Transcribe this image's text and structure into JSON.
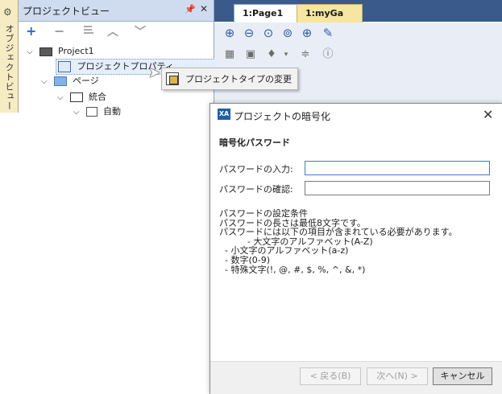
{
  "side_tab": {
    "label": "オブジェクトビュー"
  },
  "project_view": {
    "title": "プロジェクトビュー",
    "pin_icon": "pin-icon",
    "close_glyph": "✕",
    "toolbar": {
      "add": "+",
      "remove": "−",
      "rename_icon": "rename-icon",
      "up": "︿",
      "down": "﹀"
    },
    "tree": {
      "project": "Project1",
      "properties": "プロジェクトプロパティ",
      "pages": "ページ",
      "integrated": "統合",
      "auto": "自動"
    }
  },
  "editor_tabs": [
    {
      "label": "1:Page1"
    },
    {
      "label": "1:myGa"
    }
  ],
  "context_menu": {
    "item": "プロジェクトタイプの変更"
  },
  "dialog": {
    "logo": "XA",
    "title": "プロジェクトの暗号化",
    "close_glyph": "✕",
    "section_title": "暗号化パスワード",
    "password_label": "パスワードの入力:",
    "password_value": "",
    "confirm_label": "パスワードの確認:",
    "confirm_value": "",
    "rules": [
      "パスワードの設定条件",
      "パスワードの長さは最低8文字です。",
      "パスワードには以下の項目が含まれている必要があります。",
      "          - 大文字のアルファベット(A-Z)",
      "  - 小文字のアルファベット(a-z)",
      "  - 数字(0-9)",
      "  - 特殊文字(!, @, #, $, %, ^, &, *)"
    ],
    "buttons": {
      "back": "< 戻る(B)",
      "next": "次へ(N) >",
      "cancel": "キャンセル"
    }
  },
  "colors": {
    "panel_title_bg": "#cfdcef",
    "tab_strip": "#3a5a8c",
    "accent_focus": "#3b7bd1"
  }
}
